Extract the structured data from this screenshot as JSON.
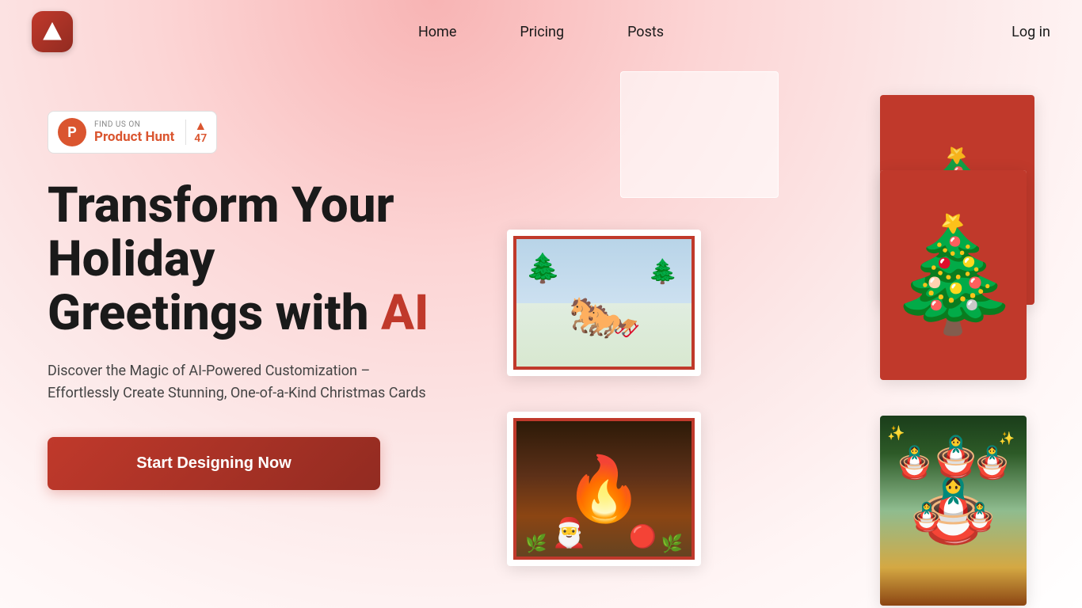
{
  "nav": {
    "links": [
      {
        "label": "Home",
        "id": "home"
      },
      {
        "label": "Pricing",
        "id": "pricing"
      },
      {
        "label": "Posts",
        "id": "posts"
      }
    ],
    "login_label": "Log in"
  },
  "product_hunt": {
    "find_us_on": "FIND US ON",
    "name": "Product Hunt",
    "count": "47",
    "logo_letter": "P"
  },
  "hero": {
    "title_part1": "Transform Your Holiday",
    "title_part2": "Greetings with ",
    "title_ai": "AI",
    "subtitle": "Discover the Magic of AI-Powered Customization – Effortlessly Create Stunning, One-of-a-Kind Christmas Cards",
    "cta_label": "Start Designing Now"
  }
}
